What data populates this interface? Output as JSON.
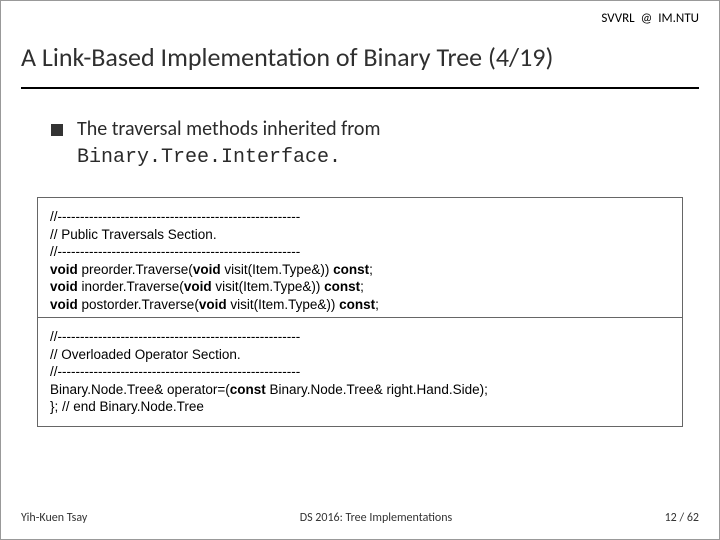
{
  "header": {
    "left_label": "SVVRL",
    "right_label": "IM.NTU"
  },
  "title": "A Link-Based Implementation of Binary Tree (4/19)",
  "bullet": {
    "lead": "The traversal methods inherited from",
    "mono": "Binary.Tree.Interface."
  },
  "code1": {
    "l1": "//------------------------------------------------------",
    "l2": "// Public Traversals Section.",
    "l3": "//------------------------------------------------------",
    "l4a": "void",
    "l4b": " preorder.Traverse(",
    "l4c": "void",
    "l4d": " visit(Item.Type&)) ",
    "l4e": "const",
    "l4f": ";",
    "l5a": "void",
    "l5b": " inorder.Traverse(",
    "l5c": "void",
    "l5d": " visit(Item.Type&)) ",
    "l5e": "const",
    "l5f": ";",
    "l6a": "void",
    "l6b": " postorder.Traverse(",
    "l6c": "void",
    "l6d": " visit(Item.Type&)) ",
    "l6e": "const",
    "l6f": ";"
  },
  "code2": {
    "l1": "//------------------------------------------------------",
    "l2": "// Overloaded Operator Section.",
    "l3": "//------------------------------------------------------",
    "l4a": "Binary.Node.Tree& operator=(",
    "l4b": "const",
    "l4c": " Binary.Node.Tree& right.Hand.Side);",
    "l5": "}; // end Binary.Node.Tree"
  },
  "footer": {
    "author": "Yih-Kuen Tsay",
    "course": "DS 2016: Tree Implementations",
    "page": "12 / 62"
  }
}
